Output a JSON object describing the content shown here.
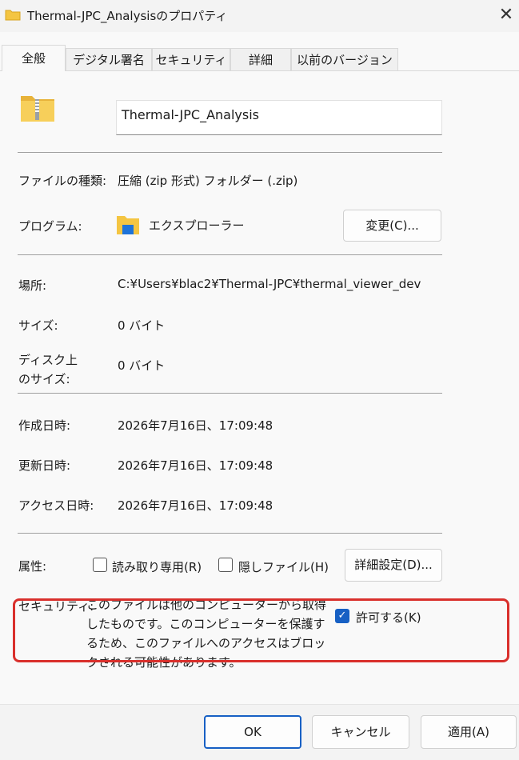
{
  "window": {
    "title": "Thermal-JPC_Analysisのプロパティ",
    "close_glyph": "✕"
  },
  "tabs": [
    {
      "label": "全般"
    },
    {
      "label": "デジタル署名"
    },
    {
      "label": "セキュリティ"
    },
    {
      "label": "詳細"
    },
    {
      "label": "以前のバージョン"
    }
  ],
  "general": {
    "file_name": "Thermal-JPC_Analysis",
    "type_label": "ファイルの種類:",
    "type_value": "圧縮 (zip 形式) フォルダー (.zip)",
    "program_label": "プログラム:",
    "program_value": "エクスプローラー",
    "change_button": "変更(C)...",
    "location_label": "場所:",
    "location_value": "C:¥Users¥blac2¥Thermal-JPC¥thermal_viewer_dev",
    "size_label": "サイズ:",
    "size_value": "0 バイト",
    "disk_size_label_1": "ディスク上",
    "disk_size_label_2": "のサイズ:",
    "disk_size_value": "0 バイト",
    "created_label": "作成日時:",
    "created_value": "2026年7月16日、17:09:48",
    "modified_label": "更新日時:",
    "modified_value": "2026年7月16日、17:09:48",
    "accessed_label": "アクセス日時:",
    "accessed_value": "2026年7月16日、17:09:48",
    "attributes_label": "属性:",
    "readonly_label": "読み取り専用(R)",
    "readonly_checked": false,
    "hidden_label": "隠しファイル(H)",
    "hidden_checked": false,
    "advanced_button": "詳細設定(D)...",
    "security_label": "セキュリティ:",
    "security_text": "このファイルは他のコンピューターから取得したものです。このコンピューターを保護するため、このファイルへのアクセスはブロックされる可能性があります。",
    "unblock_label": "許可する(K)",
    "unblock_checked": true
  },
  "footer": {
    "ok": "OK",
    "cancel": "キャンセル",
    "apply": "適用(A)"
  },
  "colors": {
    "accent": "#1760c4",
    "highlight": "#d9302c",
    "folder": "#f4c542"
  },
  "icons": {
    "zip_folder": "zip-folder-icon",
    "explorer": "explorer-folder-icon",
    "check": "✓"
  }
}
